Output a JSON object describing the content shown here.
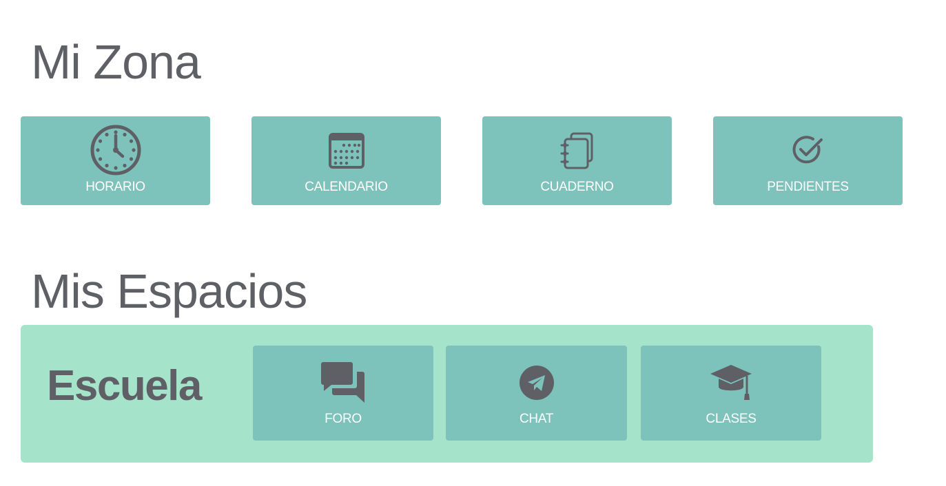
{
  "mi_zona": {
    "title": "Mi Zona",
    "tiles": [
      {
        "label": "HORARIO",
        "icon": "clock-icon"
      },
      {
        "label": "CALENDARIO",
        "icon": "calendar-icon"
      },
      {
        "label": "CUADERNO",
        "icon": "notebook-icon"
      },
      {
        "label": "PENDIENTES",
        "icon": "check-circle-icon"
      }
    ]
  },
  "mis_espacios": {
    "title": "Mis Espacios",
    "spaces": [
      {
        "name": "Escuela",
        "tiles": [
          {
            "label": "FORO",
            "icon": "forum-icon"
          },
          {
            "label": "CHAT",
            "icon": "telegram-icon"
          },
          {
            "label": "CLASES",
            "icon": "graduation-cap-icon"
          }
        ]
      }
    ]
  },
  "colors": {
    "tile": "#7dc3bc",
    "panel": "#a5e3ca",
    "text_dark": "#5f5f66",
    "text_light": "#ffffff",
    "background": "#ffffff"
  }
}
